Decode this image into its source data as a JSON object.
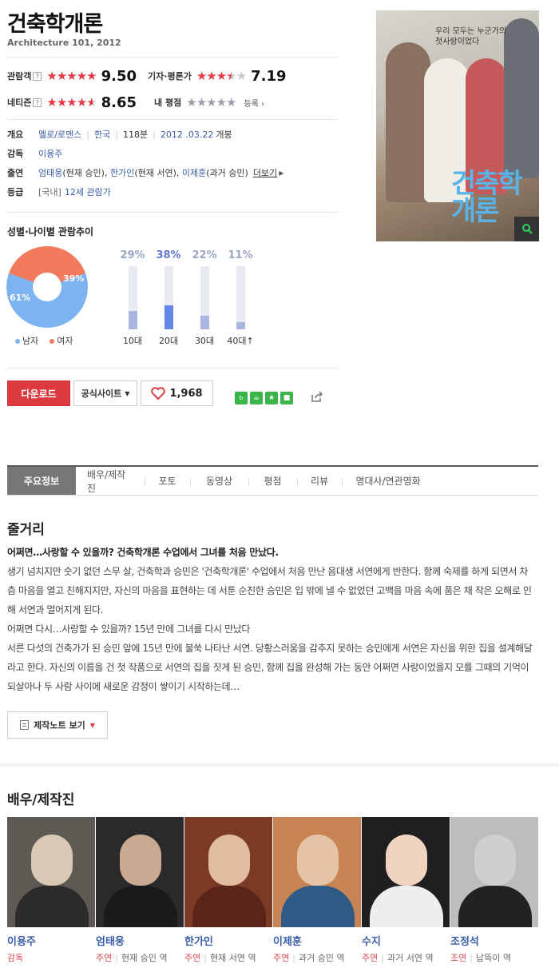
{
  "movie": {
    "title": "건축학개론",
    "subtitle": "Architecture 101, 2012"
  },
  "ratings": {
    "audience": {
      "label": "관람객",
      "help": "?",
      "stars": 5,
      "score": "9.50"
    },
    "critic": {
      "label": "기자·평론가",
      "stars": 3.5,
      "score": "7.19"
    },
    "netizen": {
      "label": "네티즌",
      "help": "?",
      "stars": 4.5,
      "score": "8.65"
    },
    "mine": {
      "label": "내 평점",
      "stars": 0,
      "link": "등록"
    }
  },
  "info": {
    "overview_label": "개요",
    "genre": "멜로/로맨스",
    "country": "한국",
    "runtime": "118분",
    "release": "2012 .03.22",
    "release_suffix": "개봉",
    "director_label": "감독",
    "director": "이용주",
    "cast_label": "출연",
    "cast_1": "엄태웅",
    "cast_1_role": "(현재 승민)",
    "cast_2": "한가인",
    "cast_2_role": "(현재 서연)",
    "cast_3": "이제훈",
    "cast_3_role": "(과거 승민)",
    "more": "더보기",
    "rating_label": "등급",
    "rating_region": "[국내]",
    "rating_value": "12세 관람가"
  },
  "poster": {
    "tagline": "우리 모두는 누군가의 첫사랑이었다",
    "title_line1": "건축학",
    "title_line2": "개론"
  },
  "demographics": {
    "title": "성별·나이별 관람추이",
    "gender": {
      "male_pct": 61,
      "female_pct": 39,
      "male_text": "61%",
      "female_text": "39%",
      "male_label": "남자",
      "female_label": "여자",
      "male_color": "#7db3f0",
      "female_color": "#f27a5e"
    },
    "age": [
      {
        "label": "10대",
        "pct": 29,
        "text": "29%"
      },
      {
        "label": "20대",
        "pct": 38,
        "text": "38%"
      },
      {
        "label": "30대",
        "pct": 22,
        "text": "22%"
      },
      {
        "label": "40대↑",
        "pct": 11,
        "text": "11%"
      }
    ]
  },
  "actions": {
    "download": "다운로드",
    "official_site": "공식사이트",
    "likes": "1,968",
    "share": [
      "blog",
      "cafe",
      "star",
      "me"
    ]
  },
  "tabs": [
    "주요정보",
    "배우/제작진",
    "포토",
    "동영상",
    "평점",
    "리뷰",
    "명대사/연관영화"
  ],
  "synopsis": {
    "title": "줄거리",
    "headline": "어쩌면…사랑할 수 있을까? 건축학개론 수업에서 그녀를 처음 만났다.",
    "p1": "생기 넘치지만 숫기 없던 스무 살, 건축학과 승민은 '건축학개론' 수업에서 처음 만난 음대생 서연에게 반한다. 함께 숙제를 하게 되면서 차츰 마음을 열고 친해지지만, 자신의 마음을 표현하는 데 서툰 순진한 승민은 입 밖에 낼 수 없었던 고백을 마음 속에 품은 채 작은 오해로 인해 서연과 멀어지게 된다.",
    "p2": " 어쩌면 다시…사랑할 수 있을까? 15년 만에 그녀를 다시 만났다",
    "p3": " 서른 다섯의 건축가가 된 승민 앞에 15년 만에 불쑥 나타난 서연. 당황스러움을 감추지 못하는 승민에게 서연은 자신을 위한 집을 설계해달라고 한다. 자신의 이름을 건 첫 작품으로 서연의 집을 짓게 된 승민, 함께 집을 완성해 가는 동안 어쩌면 사랑이었을지 모를 그때의 기억이 되살아나 두 사람 사이에 새로운 감정이 쌓이기 시작하는데…",
    "note_button": "제작노트 보기"
  },
  "cast": {
    "title": "배우/제작진",
    "people": [
      {
        "name": "이용주",
        "role": "감독",
        "character": ""
      },
      {
        "name": "엄태웅",
        "role": "주연",
        "character": "현재 승민 역"
      },
      {
        "name": "한가인",
        "role": "주연",
        "character": "현재 서연 역"
      },
      {
        "name": "이제훈",
        "role": "주연",
        "character": "과거 승민 역"
      },
      {
        "name": "수지",
        "role": "주연",
        "character": "과거 서연 역"
      },
      {
        "name": "조정석",
        "role": "조연",
        "character": "납뜩이 역"
      }
    ]
  }
}
